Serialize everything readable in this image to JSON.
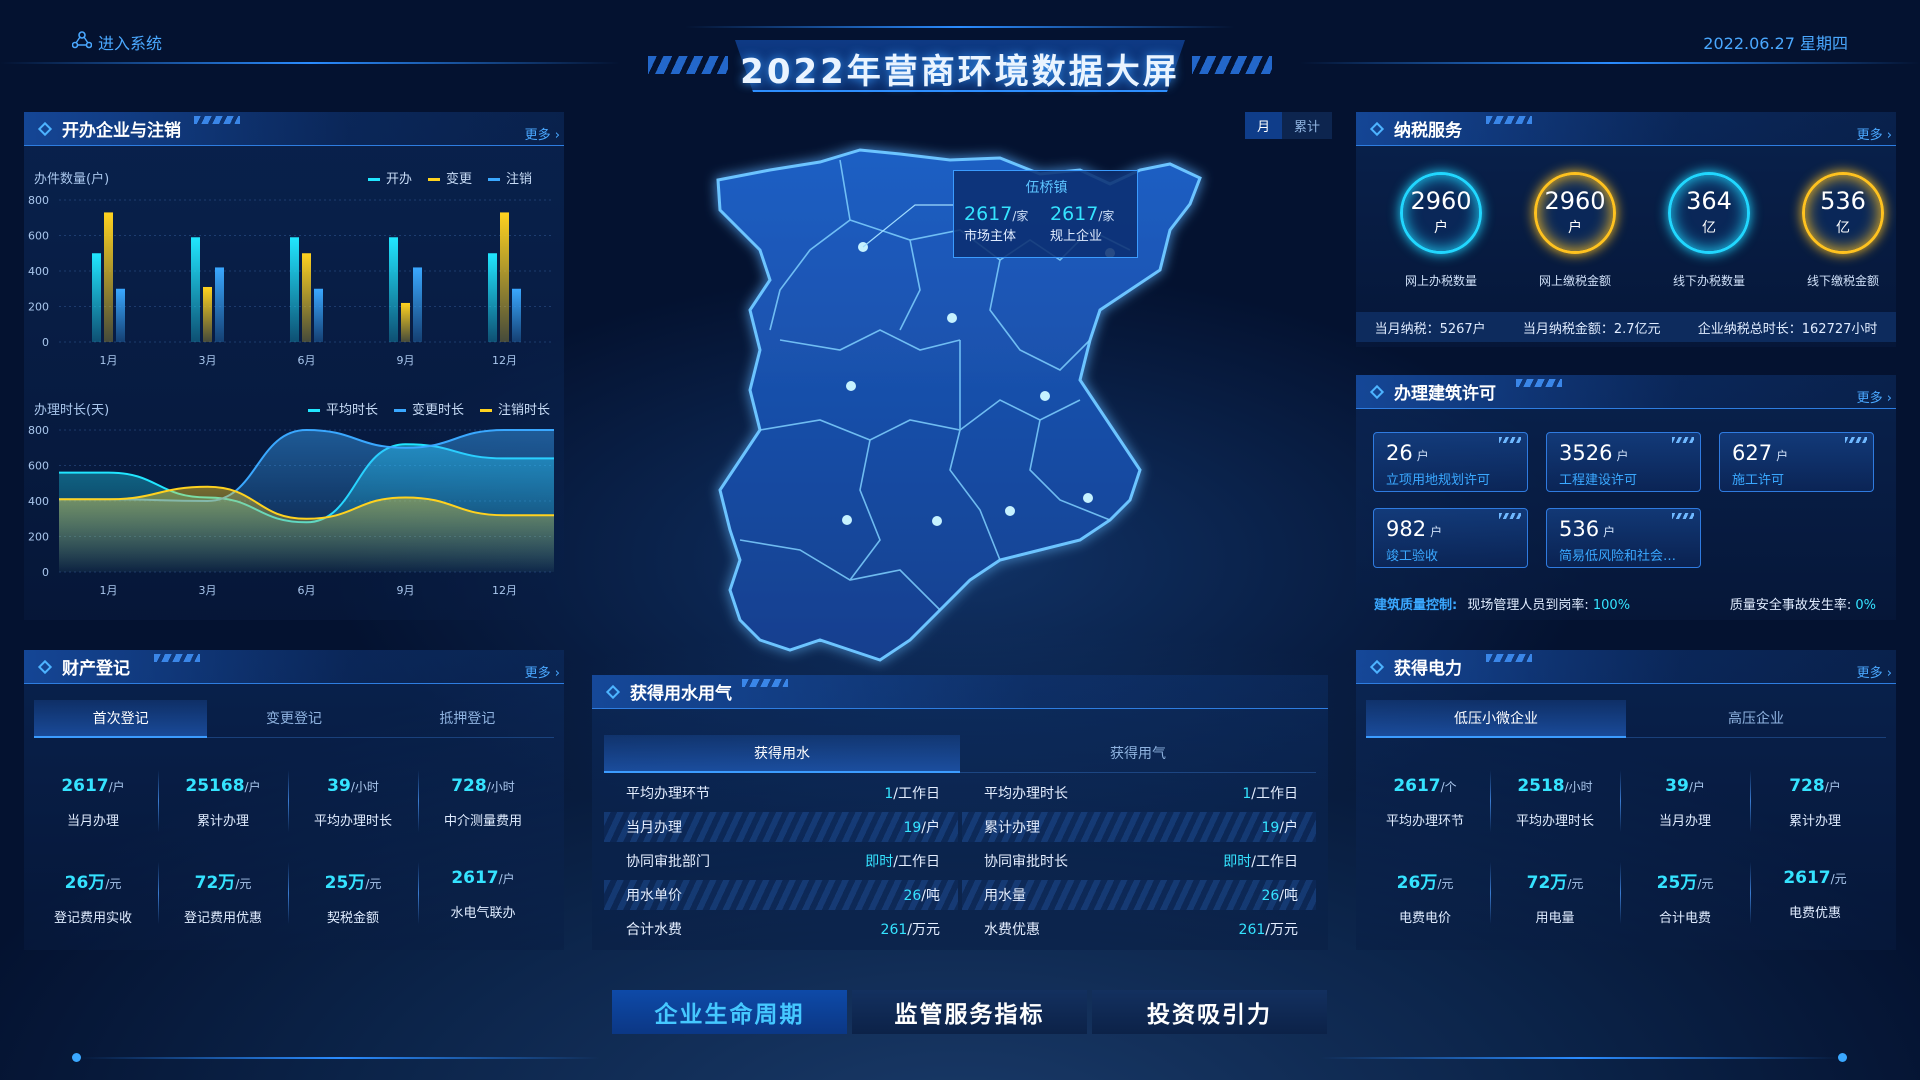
{
  "header": {
    "title": "2022年营商环境数据大屏",
    "enter_system": "进入系统",
    "date": "2022.06.27 星期四"
  },
  "panel_enterprise": {
    "title": "开办企业与注销",
    "more": "更多",
    "chart1_ylabel": "办件数量(户)",
    "chart2_ylabel": "办理时长(天)"
  },
  "chart_data": [
    {
      "type": "bar",
      "title": "",
      "ylabel": "办件数量(户)",
      "categories": [
        "1月",
        "3月",
        "6月",
        "9月",
        "12月"
      ],
      "ylim": [
        0,
        800
      ],
      "yticks": [
        0,
        200,
        400,
        600,
        800
      ],
      "series": [
        {
          "name": "开办",
          "color": "#21e6ff",
          "values": [
            500,
            590,
            590,
            590,
            500
          ]
        },
        {
          "name": "变更",
          "color": "#ffd21f",
          "values": [
            730,
            310,
            500,
            220,
            730
          ]
        },
        {
          "name": "注销",
          "color": "#3aa8ff",
          "values": [
            300,
            420,
            300,
            420,
            300
          ]
        }
      ]
    },
    {
      "type": "area",
      "title": "",
      "ylabel": "办理时长(天)",
      "categories": [
        "1月",
        "3月",
        "6月",
        "9月",
        "12月"
      ],
      "ylim": [
        0,
        800
      ],
      "yticks": [
        0,
        200,
        400,
        600,
        800
      ],
      "series": [
        {
          "name": "平均时长",
          "color": "#21e6ff",
          "values": [
            560,
            420,
            280,
            720,
            640
          ]
        },
        {
          "name": "变更时长",
          "color": "#3aa8ff",
          "values": [
            410,
            400,
            800,
            700,
            800
          ]
        },
        {
          "name": "注销时长",
          "color": "#ffd21f",
          "values": [
            410,
            480,
            300,
            420,
            320
          ]
        }
      ]
    }
  ],
  "panel_property": {
    "title": "财产登记",
    "more": "更多",
    "tabs": [
      "首次登记",
      "变更登记",
      "抵押登记"
    ],
    "stats": [
      {
        "value": "2617",
        "unit": "/户",
        "label": "当月办理"
      },
      {
        "value": "25168",
        "unit": "/户",
        "label": "累计办理"
      },
      {
        "value": "39",
        "unit": "/小时",
        "label": "平均办理时长"
      },
      {
        "value": "728",
        "unit": "/小时",
        "label": "中介测量费用"
      },
      {
        "value": "26万",
        "unit": "/元",
        "label": "登记费用实收"
      },
      {
        "value": "72万",
        "unit": "/元",
        "label": "登记费用优惠"
      },
      {
        "value": "25万",
        "unit": "/元",
        "label": "契税金额"
      },
      {
        "value": "2617",
        "unit": "/户",
        "label": "水电气联办"
      }
    ]
  },
  "map": {
    "toggle": [
      "月",
      "累计"
    ],
    "popup_title": "伍桥镇",
    "popup_left_value": "2617",
    "popup_left_unit": "/家",
    "popup_left_label": "市场主体",
    "popup_right_value": "2617",
    "popup_right_unit": "/家",
    "popup_right_label": "规上企业"
  },
  "panel_water": {
    "title": "获得用水用气",
    "tabs": [
      "获得用水",
      "获得用气"
    ],
    "left_rows": [
      {
        "key": "平均办理环节",
        "num": "1",
        "unit": "/工作日"
      },
      {
        "key": "当月办理",
        "num": "19",
        "unit": "/户"
      },
      {
        "key": "协同审批部门",
        "num": "即时",
        "unit": "/工作日"
      },
      {
        "key": "用水单价",
        "num": "26",
        "unit": "/吨"
      },
      {
        "key": "合计水费",
        "num": "261",
        "unit": "/万元"
      }
    ],
    "right_rows": [
      {
        "key": "平均办理时长",
        "num": "1",
        "unit": "/工作日"
      },
      {
        "key": "累计办理",
        "num": "19",
        "unit": "/户"
      },
      {
        "key": "协同审批时长",
        "num": "即时",
        "unit": "/工作日"
      },
      {
        "key": "用水量",
        "num": "26",
        "unit": "/吨"
      },
      {
        "key": "水费优惠",
        "num": "261",
        "unit": "/万元"
      }
    ]
  },
  "panel_tax": {
    "title": "纳税服务",
    "more": "更多",
    "circles": [
      {
        "value": "2960",
        "unit": "户",
        "label": "网上办税数量",
        "color": "#21d7ff"
      },
      {
        "value": "2960",
        "unit": "户",
        "label": "网上缴税金额",
        "color": "#ffc21f"
      },
      {
        "value": "364",
        "unit": "亿",
        "label": "线下办税数量",
        "color": "#21d7ff"
      },
      {
        "value": "536",
        "unit": "亿",
        "label": "线下缴税金额",
        "color": "#ffc21f"
      }
    ],
    "summary": [
      "当月纳税：5267户",
      "当月纳税金额：2.7亿元",
      "企业纳税总时长：162727小时"
    ]
  },
  "panel_build": {
    "title": "办理建筑许可",
    "more": "更多",
    "cards": [
      {
        "value": "26",
        "unit": "户",
        "label": "立项用地规划许可"
      },
      {
        "value": "3526",
        "unit": "户",
        "label": "工程建设许可"
      },
      {
        "value": "627",
        "unit": "户",
        "label": "施工许可"
      },
      {
        "value": "982",
        "unit": "户",
        "label": "竣工验收"
      },
      {
        "value": "536",
        "unit": "户",
        "label": "简易低风险和社会…"
      }
    ],
    "quality_label": "建筑质量控制:",
    "quality_1_label": "现场管理人员到岗率:",
    "quality_1_value": "100%",
    "quality_2_label": "质量安全事故发生率:",
    "quality_2_value": "0%"
  },
  "panel_power": {
    "title": "获得电力",
    "more": "更多",
    "tabs": [
      "低压小微企业",
      "高压企业"
    ],
    "stats": [
      {
        "value": "2617",
        "unit": "/个",
        "label": "平均办理环节"
      },
      {
        "value": "2518",
        "unit": "/小时",
        "label": "平均办理时长"
      },
      {
        "value": "39",
        "unit": "/户",
        "label": "当月办理"
      },
      {
        "value": "728",
        "unit": "/户",
        "label": "累计办理"
      },
      {
        "value": "26万",
        "unit": "/元",
        "label": "电费电价"
      },
      {
        "value": "72万",
        "unit": "/元",
        "label": "用电量"
      },
      {
        "value": "25万",
        "unit": "/元",
        "label": "合计电费"
      },
      {
        "value": "2617",
        "unit": "/元",
        "label": "电费优惠"
      }
    ]
  },
  "bottom_nav": [
    "企业生命周期",
    "监管服务指标",
    "投资吸引力"
  ]
}
